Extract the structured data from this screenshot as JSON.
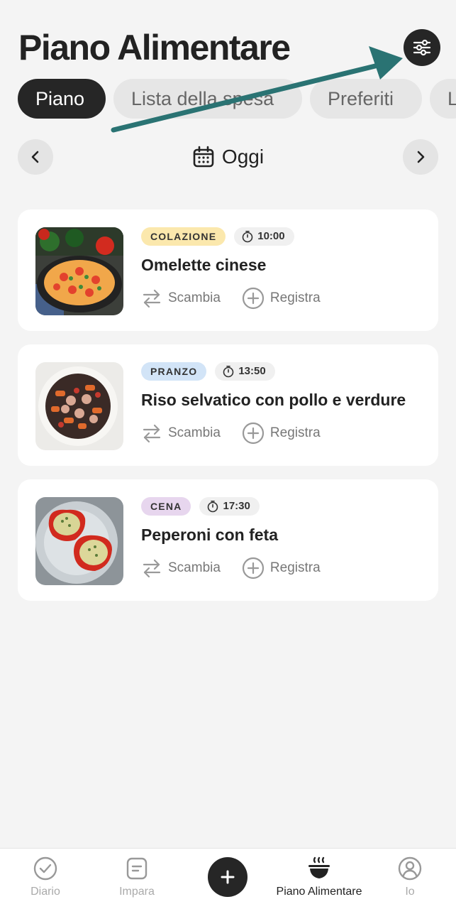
{
  "header": {
    "title": "Piano Alimentare",
    "settings_icon": "sliders-icon"
  },
  "tabs": [
    {
      "label": "Piano",
      "active": true
    },
    {
      "label": "Lista della spesa",
      "active": false
    },
    {
      "label": "Preferiti",
      "active": false
    },
    {
      "label": "L",
      "active": false
    }
  ],
  "date_nav": {
    "label": "Oggi",
    "icon": "calendar-icon"
  },
  "meals": [
    {
      "type": "COLAZIONE",
      "type_color": "#fbe8ad",
      "time": "10:00",
      "name": "Omelette cinese",
      "swap_label": "Scambia",
      "log_label": "Registra",
      "image": "omelette-photo"
    },
    {
      "type": "PRANZO",
      "type_color": "#d2e4f7",
      "time": "13:50",
      "name": "Riso selvatico con pollo e verdure",
      "swap_label": "Scambia",
      "log_label": "Registra",
      "image": "wild-rice-photo"
    },
    {
      "type": "CENA",
      "type_color": "#e7d6ee",
      "time": "17:30",
      "name": "Peperoni con feta",
      "swap_label": "Scambia",
      "log_label": "Registra",
      "image": "stuffed-peppers-photo"
    }
  ],
  "bottom_nav": {
    "items": [
      {
        "label": "Diario",
        "icon": "check-circle-icon",
        "active": false
      },
      {
        "label": "Impara",
        "icon": "document-icon",
        "active": false
      },
      {
        "label": "Piano Alimentare",
        "icon": "bowl-icon",
        "active": true
      },
      {
        "label": "Io",
        "icon": "user-circle-icon",
        "active": false
      }
    ],
    "add_icon": "plus-icon"
  },
  "annotation": {
    "arrow_color": "#2a7373"
  }
}
